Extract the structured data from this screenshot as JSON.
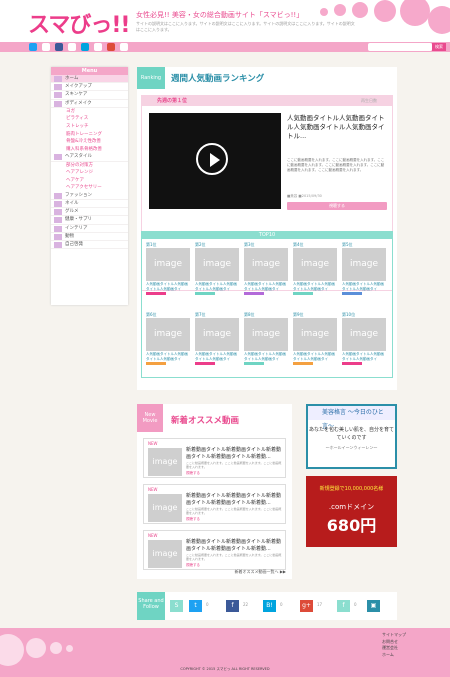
{
  "header": {
    "logo": "スマびっ!!",
    "tagline": "女性必見!! 美容・女の総合動画サイト「スマビっ!!」",
    "description": "サイトの説明文はここに入ります。サイトの説明文はここに入ります。サイトの説明文はここに入ります。サイトの説明文はここに入ります。"
  },
  "nav": {
    "search_button": "検索"
  },
  "sidebar": {
    "title": "Menu",
    "items": [
      {
        "label": "ホーム",
        "type": "home"
      },
      {
        "label": "メイクアップ",
        "type": "cat"
      },
      {
        "label": "スキンケア",
        "type": "cat"
      },
      {
        "label": "ボディメイク",
        "type": "cat"
      },
      {
        "label": "ヨガ",
        "type": "sub"
      },
      {
        "label": "ピラティス",
        "type": "sub"
      },
      {
        "label": "ストレッチ",
        "type": "sub"
      },
      {
        "label": "筋肉トレーニング",
        "type": "sub"
      },
      {
        "label": "骨盤&冷え性改善",
        "type": "sub"
      },
      {
        "label": "購入科系骨格改善",
        "type": "sub"
      },
      {
        "label": "ヘアスタイル",
        "type": "cat"
      },
      {
        "label": "部分の対策方",
        "type": "sub"
      },
      {
        "label": "ヘアアレンジ",
        "type": "sub"
      },
      {
        "label": "ヘアケア",
        "type": "sub"
      },
      {
        "label": "ヘアアクセサリー",
        "type": "sub"
      },
      {
        "label": "ファッション",
        "type": "cat"
      },
      {
        "label": "ネイル",
        "type": "cat"
      },
      {
        "label": "グルメ",
        "type": "cat"
      },
      {
        "label": "健康・サプリ",
        "type": "cat"
      },
      {
        "label": "インテリア",
        "type": "cat"
      },
      {
        "label": "動物",
        "type": "cat"
      },
      {
        "label": "自己啓発",
        "type": "cat"
      }
    ]
  },
  "ranking": {
    "label": "Ranking",
    "title": "週間人気動画ランキング",
    "first": {
      "header": "先週の第１位",
      "date": "再生日数",
      "title": "人気動画タイトル人気動画タイトル人気動画タイトル人気動画タイトル...",
      "desc": "ここに動画概要を入れます。ここに動画概要を入れます。ここに動画概要を入れます。ここに動画概要を入れます。ここに動画概要を入れます。ここに動画概要を入れます。",
      "meta": "■美容 ■2015/09/30",
      "button": "視聴する"
    },
    "top10_title": "TOP10",
    "cards": [
      {
        "rank": "第1位",
        "title": "人気動画タイトル人気動画タイトル人気動画タイ",
        "tag_color": "#ec3d8a",
        "image": "image"
      },
      {
        "rank": "第2位",
        "title": "人気動画タイトル人気動画タイトル人気動画タイ",
        "tag_color": "#6fd4c3",
        "image": "image"
      },
      {
        "rank": "第3位",
        "title": "人気動画タイトル人気動画タイトル人気動画タイ",
        "tag_color": "#b36ad9",
        "image": "image"
      },
      {
        "rank": "第4位",
        "title": "人気動画タイトル人気動画タイトル人気動画タイ",
        "tag_color": "#6fd4c3",
        "image": "image"
      },
      {
        "rank": "第5位",
        "title": "人気動画タイトル人気動画タイトル人気動画タイ",
        "tag_color": "#5b8fd9",
        "image": "image"
      },
      {
        "rank": "第6位",
        "title": "人気動画タイトル人気動画タイトル人気動画タイ",
        "tag_color": "#f4a040",
        "image": "image"
      },
      {
        "rank": "第7位",
        "title": "人気動画タイトル人気動画タイトル人気動画タイ",
        "tag_color": "#ec3d8a",
        "image": "image"
      },
      {
        "rank": "第8位",
        "title": "人気動画タイトル人気動画タイトル人気動画タイ",
        "tag_color": "#6fd4c3",
        "image": "image"
      },
      {
        "rank": "第9位",
        "title": "人気動画タイトル人気動画タイトル人気動画タイ",
        "tag_color": "#f4a040",
        "image": "image"
      },
      {
        "rank": "第10位",
        "title": "人気動画タイトル人気動画タイトル人気動画タイ",
        "tag_color": "#ec3d8a",
        "image": "image"
      }
    ]
  },
  "newmovie": {
    "label": "New Movie",
    "title": "新着オススメ動画",
    "more": "新着オススメ動画一覧へ ▶▶",
    "items": [
      {
        "badge": "NEW",
        "title": "新着動画タイトル新着動画タイトル新着動画タイトル新着動画タイトル新着動...",
        "desc": "ここに動画概要を入れます。ここに動画概要を入れます。ここに動画概要を入れます。",
        "button": "視聴する",
        "image": "image"
      },
      {
        "badge": "NEW",
        "title": "新着動画タイトル新着動画タイトル新着動画タイトル新着動画タイトル新着動...",
        "desc": "ここに動画概要を入れます。ここに動画概要を入れます。ここに動画概要を入れます。",
        "button": "視聴する",
        "image": "image"
      },
      {
        "badge": "NEW",
        "title": "新着動画タイトル新着動画タイトル新着動画タイトル新着動画タイトル新着動...",
        "desc": "ここに動画概要を入れます。ここに動画概要を入れます。ここに動画概要を入れます。",
        "button": "視聴する",
        "image": "image"
      }
    ]
  },
  "ads": {
    "ad1_head": "美容格言 〜今日のひと言〜",
    "ad1_text": "あなたを包む美しい肌を、自分を育てていくのです",
    "ad1_author": "〜ホールイーンウィーレン〜",
    "ad2_top": "新規登録で10,000,000名様",
    "ad2_mid": ".comドメイン",
    "ad2_price": "680円"
  },
  "share": {
    "label": "Share and Follow",
    "counts": [
      "0",
      "22",
      "0",
      "17",
      "0"
    ]
  },
  "footer": {
    "links": [
      "サイトマップ",
      "お問合せ",
      "運営会社",
      "ホーム"
    ],
    "copyright": "COPYRIGHT © 2015 スマビっ ALL RIGHT RESERVED"
  }
}
